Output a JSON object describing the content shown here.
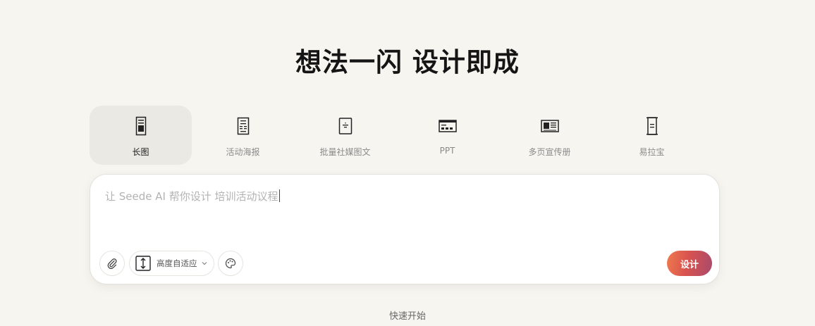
{
  "hero": {
    "title": "想法一闪 设计即成"
  },
  "tabs": [
    {
      "label": "长图",
      "icon": "long-image-icon",
      "active": true
    },
    {
      "label": "活动海报",
      "icon": "poster-icon",
      "active": false
    },
    {
      "label": "批量社媒图文",
      "icon": "social-post-icon",
      "active": false
    },
    {
      "label": "PPT",
      "icon": "ppt-icon",
      "active": false
    },
    {
      "label": "多页宣传册",
      "icon": "brochure-icon",
      "active": false
    },
    {
      "label": "易拉宝",
      "icon": "rollup-banner-icon",
      "active": false
    }
  ],
  "composer": {
    "placeholder": "让 Seede AI 帮你设计 培训活动议程",
    "size_option": "高度自适应",
    "submit_label": "设计"
  },
  "footer": {
    "quick_start": "快速开始"
  },
  "colors": {
    "background": "#f7f5f0",
    "active_tab": "#ebe9e4",
    "accent_start": "#f07a4e",
    "accent_end": "#a94a6b"
  }
}
